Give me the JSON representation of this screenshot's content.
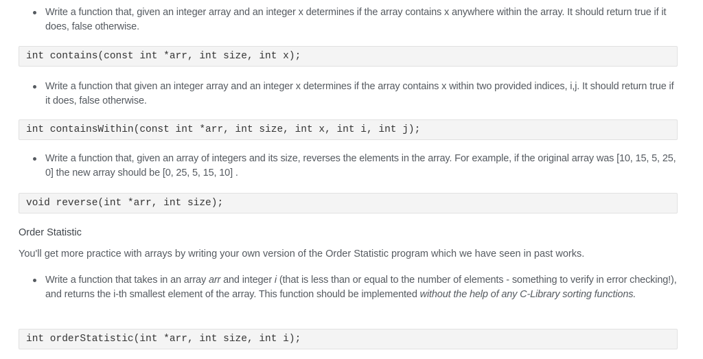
{
  "items": [
    {
      "bullet": "Write a function that, given an integer array and an integer x determines if the array contains x anywhere within the array. It should return true if it does, false otherwise.",
      "code": "int contains(const int *arr, int size, int x);"
    },
    {
      "bullet": "Write a function that given an integer array and an integer x determines if the array contains x within two provided indices, i,j. It should return true if it does, false otherwise.",
      "code": "int containsWithin(const int *arr, int size, int x, int i, int j);"
    },
    {
      "bullet": "Write a function that, given an array of integers and its size, reverses the elements in the array. For example, if the original array was [10, 15, 5, 25, 0] the new array should be [0, 25, 5, 15, 10] .",
      "code": "void reverse(int *arr, int size);"
    }
  ],
  "order_statistic": {
    "heading": "Order Statistic",
    "intro": "You'll get more practice with arrays by writing your own version of the Order Statistic program which we have seen in past works.",
    "bullet": {
      "part1": "Write a function that takes in an array ",
      "arr_em": "arr",
      "part2": " and integer ",
      "i_em": "i",
      "part3": " (that is less than or equal to the number of elements - something to verify in error checking!), and returns the i-th smallest element of the array. This function should be implemented ",
      "em_tail": "without the help of any C-Library sorting functions."
    },
    "code": "int orderStatistic(int *arr, int size, int i);"
  }
}
